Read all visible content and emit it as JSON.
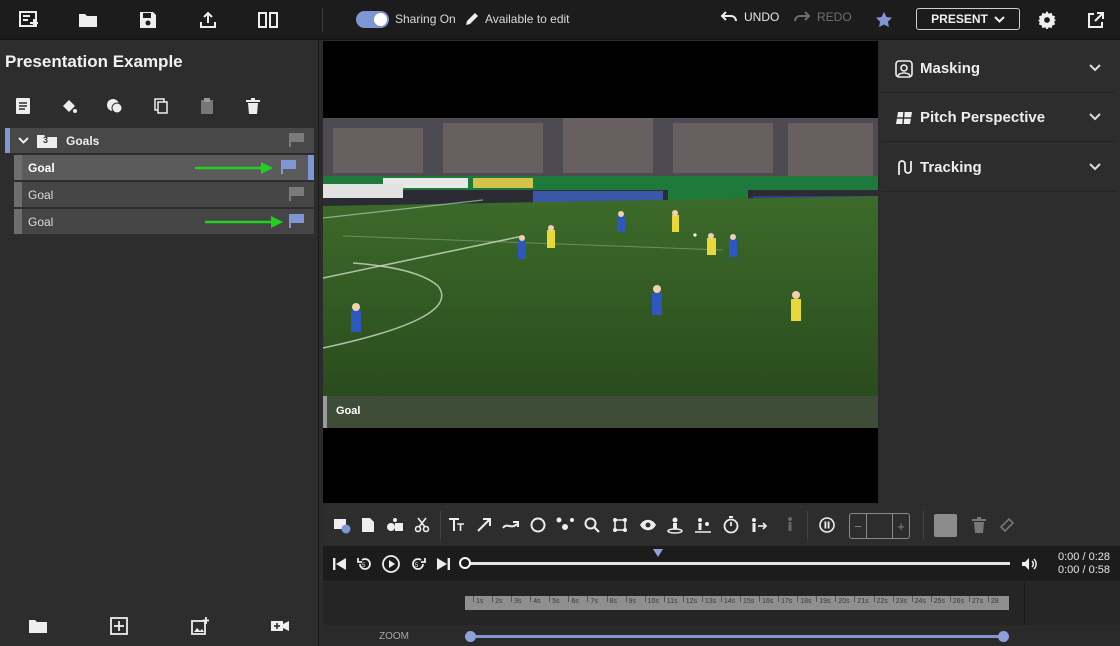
{
  "toolbar": {
    "sharing_label": "Sharing On",
    "edit_label": "Available to edit",
    "undo_label": "UNDO",
    "redo_label": "REDO",
    "present_label": "PRESENT"
  },
  "sidebar": {
    "title": "Presentation Example",
    "group": {
      "label": "Goals",
      "count": "3"
    },
    "clips": [
      {
        "label": "Goal",
        "selected": true,
        "flag_color": "#7f96d4"
      },
      {
        "label": "Goal",
        "selected": false,
        "flag_color": "#7a7a7a"
      },
      {
        "label": "Goal",
        "selected": false,
        "flag_color": "#7f96d4"
      }
    ]
  },
  "video": {
    "caption": "Goal"
  },
  "panels": [
    {
      "label": "Masking",
      "icon": "mask-icon"
    },
    {
      "label": "Pitch Perspective",
      "icon": "pitch-icon"
    },
    {
      "label": "Tracking",
      "icon": "tracking-icon"
    }
  ],
  "player": {
    "time_current": "0:00 / 0:28",
    "time_total": "0:00 / 0:58",
    "progress": 0
  },
  "timeline": {
    "ticks": [
      "1s",
      "2s",
      "3s",
      "4s",
      "5s",
      "6s",
      "7s",
      "8s",
      "9s",
      "10s",
      "11s",
      "12s",
      "13s",
      "14s",
      "15s",
      "16s",
      "17s",
      "18s",
      "19s",
      "20s",
      "21s",
      "22s",
      "23s",
      "24s",
      "25s",
      "26s",
      "27s",
      "28"
    ]
  },
  "zoom": {
    "label": "ZOOM"
  },
  "colors": {
    "accent": "#7f96d4",
    "arrow": "#1ed31e"
  }
}
